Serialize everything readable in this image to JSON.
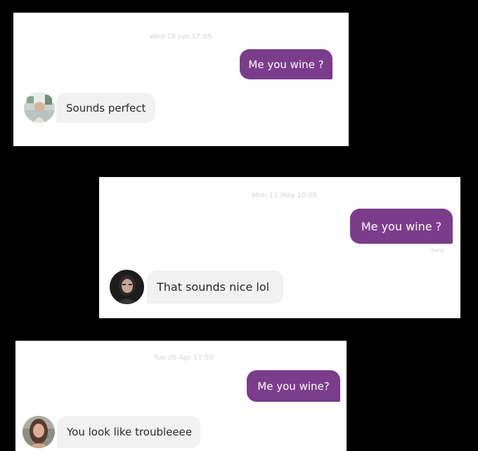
{
  "colors": {
    "sent_bubble": "#7b3d8b",
    "received_bubble": "#f1f1f1",
    "background": "#000000",
    "card": "#ffffff"
  },
  "conversations": [
    {
      "timestamp": "Wed 16 Jun 17:05",
      "sent_message": "Me you wine ?",
      "received_message": "Sounds perfect",
      "avatar_icon": "profile-photo-icon"
    },
    {
      "timestamp": "Mon 11 May 10:05",
      "sent_message": "Me you wine ?",
      "receipt": "Sent",
      "received_message": "That sounds nice lol",
      "avatar_icon": "profile-photo-icon"
    },
    {
      "timestamp": "Tue 26 Apr 11:50",
      "sent_message": "Me you wine?",
      "received_message": "You look like troubleeee",
      "avatar_icon": "profile-photo-icon"
    }
  ]
}
